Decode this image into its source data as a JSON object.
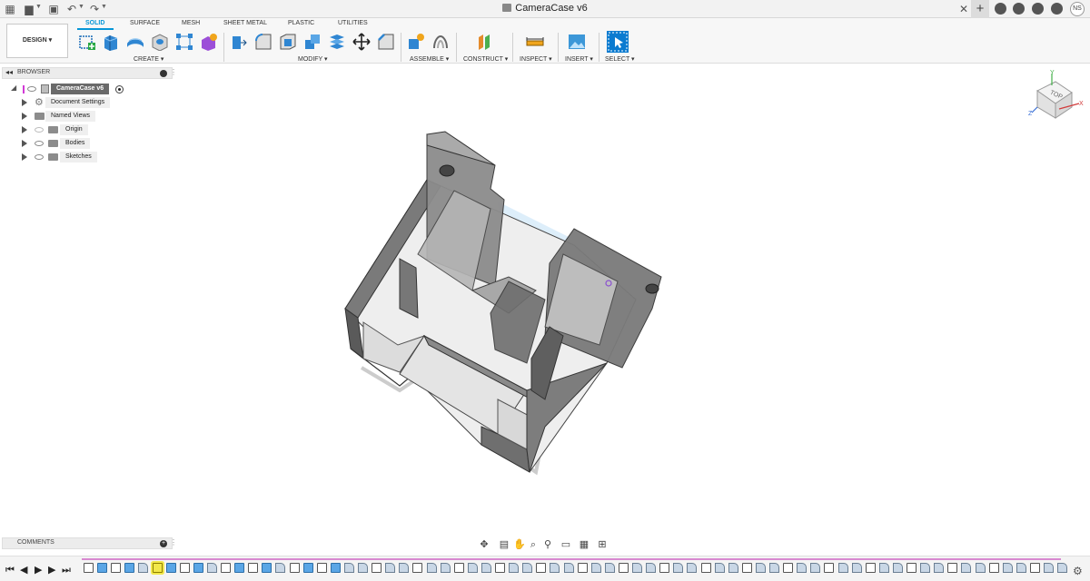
{
  "window": {
    "document_title": "CameraCase v6",
    "user_initials": "NS",
    "icons": [
      "grid-menu-icon",
      "file-icon",
      "save-icon",
      "undo-icon",
      "redo-icon",
      "close-icon",
      "plus-icon",
      "extensions-icon",
      "job-status-icon",
      "notifications-icon",
      "help-icon"
    ]
  },
  "toolbar": {
    "workspace": "DESIGN",
    "tabs": [
      {
        "label": "SOLID",
        "active": true
      },
      {
        "label": "SURFACE",
        "active": false
      },
      {
        "label": "MESH",
        "active": false
      },
      {
        "label": "SHEET METAL",
        "active": false
      },
      {
        "label": "PLASTIC",
        "active": false
      },
      {
        "label": "UTILITIES",
        "active": false
      }
    ],
    "groups": [
      {
        "label": "CREATE",
        "tools": [
          "sketch-icon",
          "extrude-icon",
          "revolve-icon",
          "hole-icon",
          "rectangular-pattern-icon",
          "create-form-icon"
        ]
      },
      {
        "label": "MODIFY",
        "tools": [
          "press-pull-icon",
          "fillet-icon",
          "shell-icon",
          "combine-icon",
          "offset-face-icon",
          "move-icon",
          "chamfer-icon"
        ]
      },
      {
        "label": "ASSEMBLE",
        "tools": [
          "new-component-icon",
          "joint-icon"
        ]
      },
      {
        "label": "CONSTRUCT",
        "tools": [
          "offset-plane-icon"
        ]
      },
      {
        "label": "INSPECT",
        "tools": [
          "measure-icon"
        ]
      },
      {
        "label": "INSERT",
        "tools": [
          "insert-image-icon"
        ]
      },
      {
        "label": "SELECT",
        "tools": [
          "select-icon"
        ]
      }
    ],
    "accent_color": "#0696d7"
  },
  "browser": {
    "title": "BROWSER",
    "root": "CameraCase v6",
    "items": [
      {
        "label": "Document Settings",
        "icon": "gear-icon"
      },
      {
        "label": "Named Views",
        "icon": "folder-icon"
      },
      {
        "label": "Origin",
        "icon": "folder-icon"
      },
      {
        "label": "Bodies",
        "icon": "folder-icon"
      },
      {
        "label": "Sketches",
        "icon": "folder-icon"
      }
    ]
  },
  "comments": {
    "title": "COMMENTS"
  },
  "viewcube": {
    "face": "TOP",
    "axes": [
      "Y",
      "X",
      "Z"
    ]
  },
  "navbar": {
    "tools": [
      "orbit-icon",
      "look-at-icon",
      "pan-icon",
      "zoom-icon",
      "fit-icon",
      "display-settings-icon",
      "grid-settings-icon",
      "viewports-icon"
    ]
  },
  "timeline": {
    "controls": [
      "go-to-start-icon",
      "step-back-icon",
      "play-icon",
      "step-forward-icon",
      "go-to-end-icon"
    ],
    "feature_count": 72,
    "highlighted_index": 5,
    "settings_icon": "gear-icon"
  }
}
